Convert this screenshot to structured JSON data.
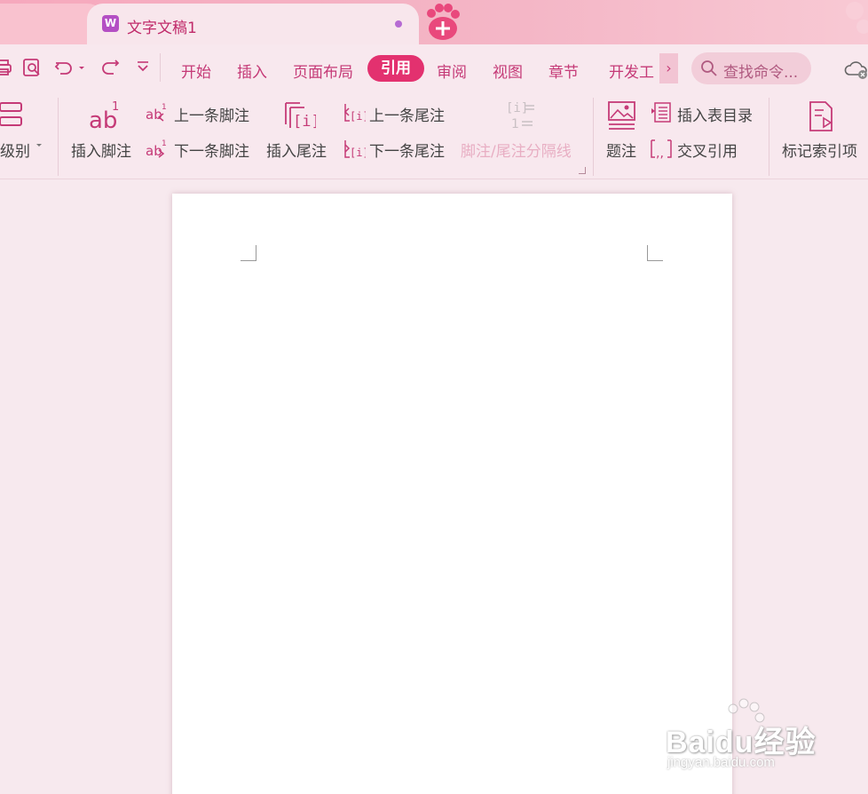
{
  "tab": {
    "title": "文字文稿1",
    "logo_letter": "W"
  },
  "menu": {
    "items": [
      "开始",
      "插入",
      "页面布局",
      "引用",
      "审阅",
      "视图",
      "章节",
      "开发工"
    ],
    "active": "引用",
    "more": "›"
  },
  "search": {
    "placeholder": "查找命令..."
  },
  "ribbon": {
    "level": "级别",
    "insert_footnote": "插入脚注",
    "prev_footnote": "上一条脚注",
    "next_footnote": "下一条脚注",
    "insert_endnote": "插入尾注",
    "prev_endnote": "上一条尾注",
    "next_endnote": "下一条尾注",
    "separator": "脚注/尾注分隔线",
    "caption": "题注",
    "insert_toc_table": "插入表目录",
    "cross_reference": "交叉引用",
    "mark_index": "标记索引项"
  },
  "watermark": {
    "brand": "Baidu经验",
    "url": "jingyan.baidu.com"
  },
  "colors": {
    "accent": "#e3316f",
    "menu_text": "#c53a77",
    "background": "#f7e9ee"
  }
}
